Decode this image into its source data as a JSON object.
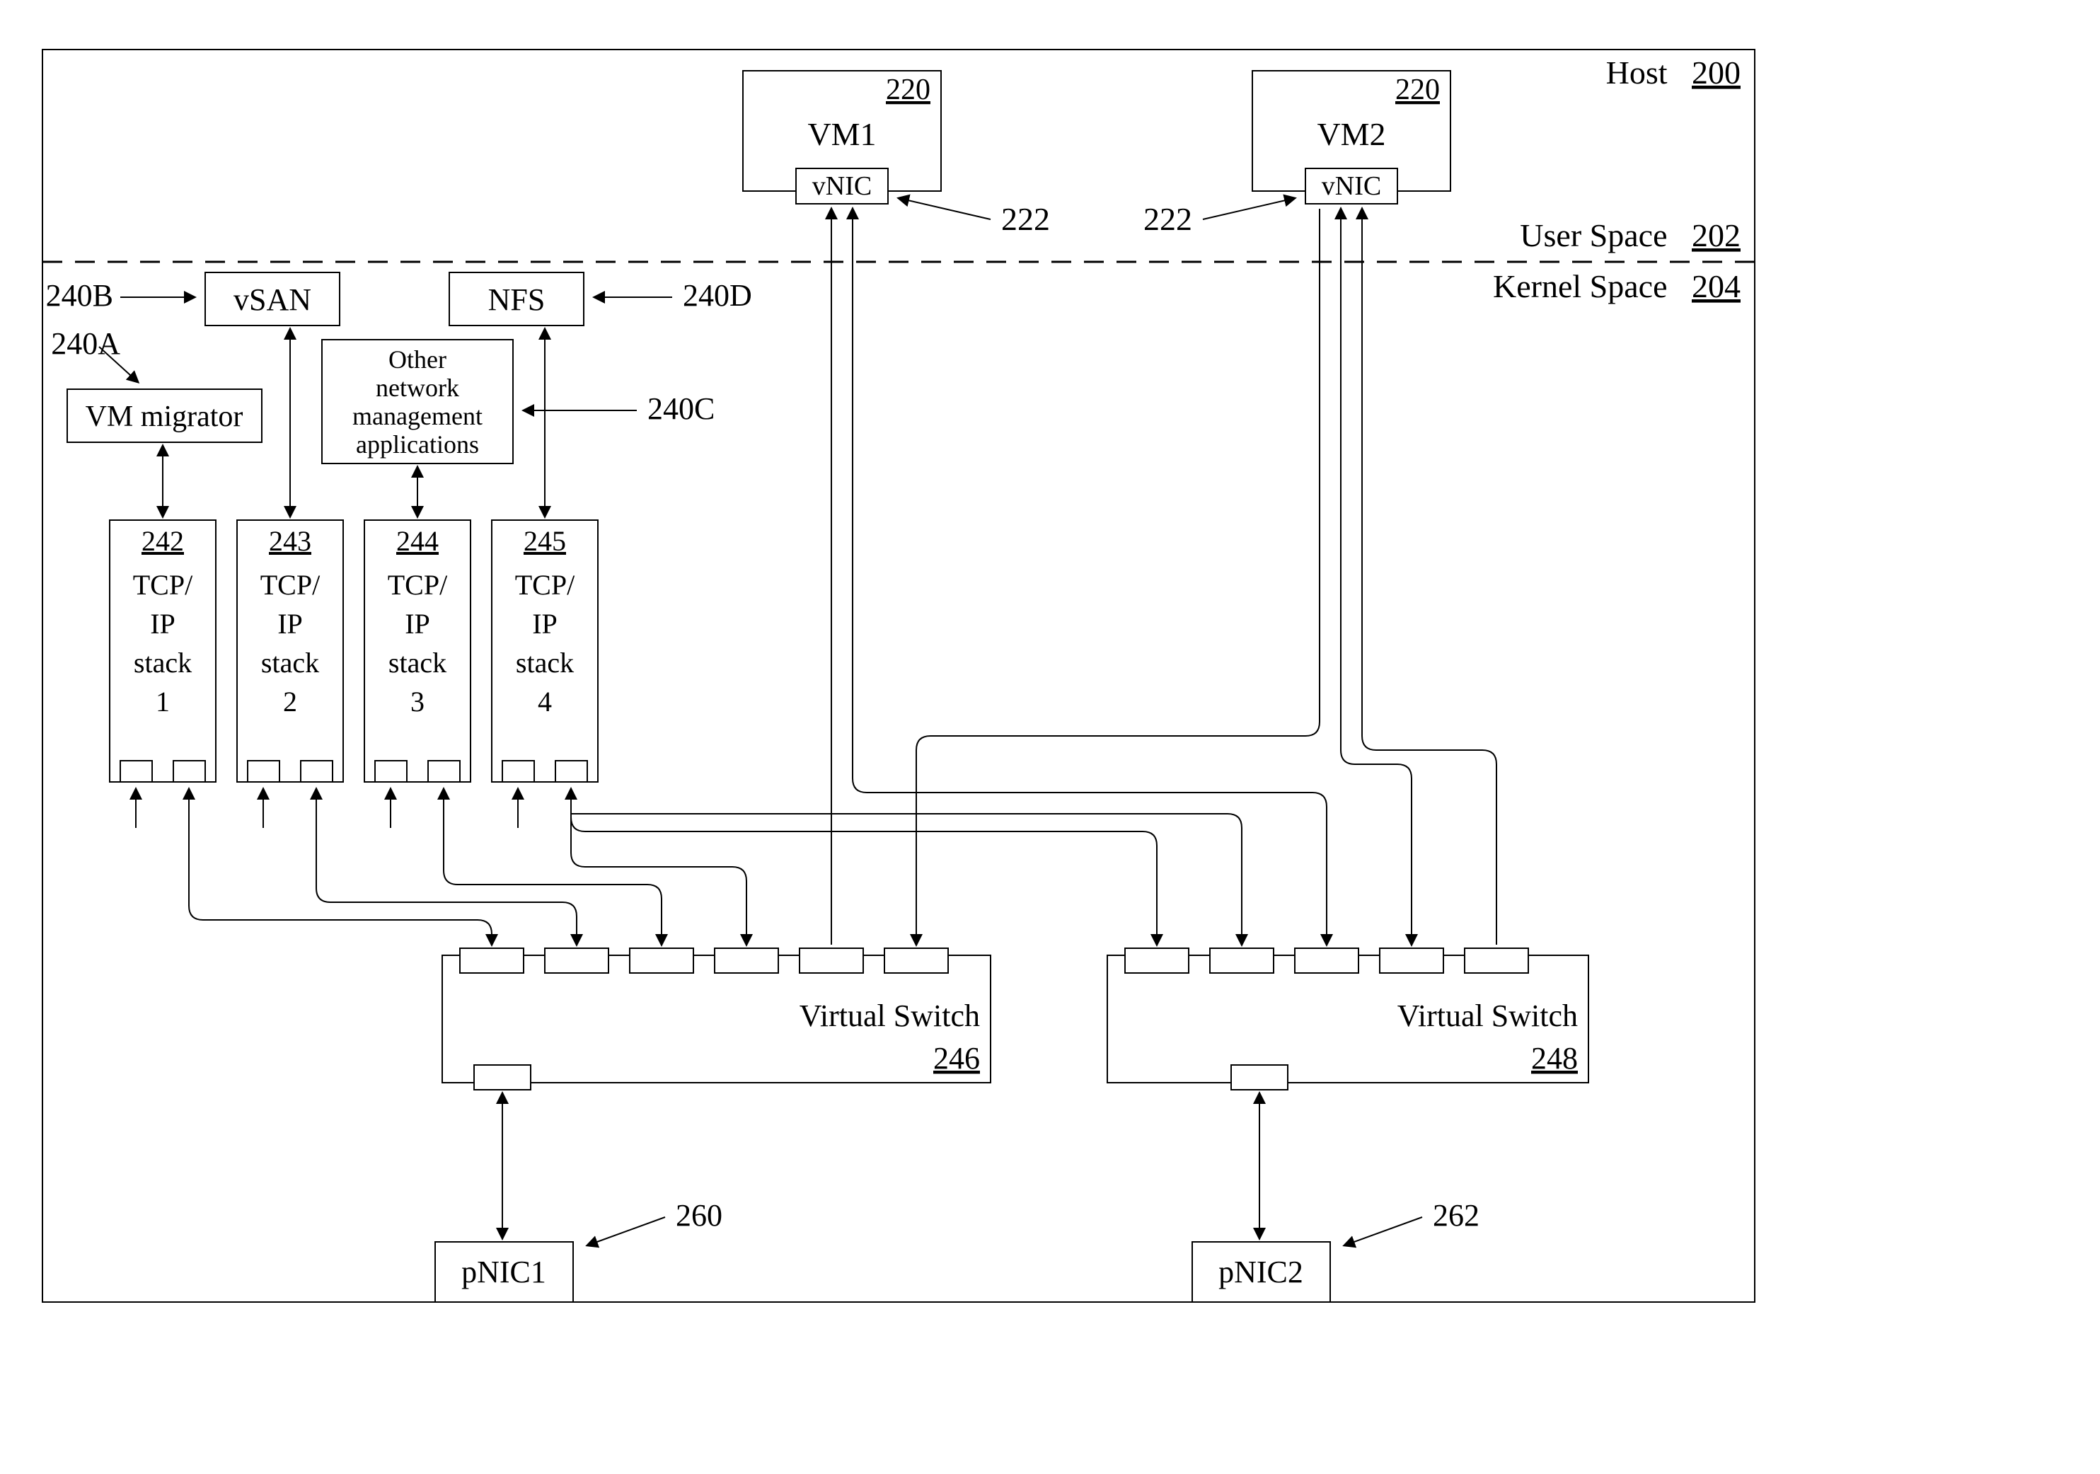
{
  "host": {
    "label": "Host",
    "ref": "200"
  },
  "user_space": {
    "label": "User Space",
    "ref": "202"
  },
  "kernel_space": {
    "label": "Kernel Space",
    "ref": "204"
  },
  "vm1": {
    "label": "VM1",
    "ref": "220",
    "nic": "vNIC",
    "callout": "222"
  },
  "vm2": {
    "label": "VM2",
    "ref": "220",
    "nic": "vNIC",
    "callout": "222"
  },
  "apps": {
    "vsan": {
      "label": "vSAN",
      "callout": "240B"
    },
    "nfs": {
      "label": "NFS",
      "callout": "240D"
    },
    "migrator": {
      "label": "VM migrator",
      "callout": "240A"
    },
    "other": {
      "line1": "Other",
      "line2": "network",
      "line3": "management",
      "line4": "applications",
      "callout": "240C"
    }
  },
  "stacks": {
    "s1": {
      "ref": "242",
      "l1": "TCP/",
      "l2": "IP",
      "l3": "stack",
      "l4": "1"
    },
    "s2": {
      "ref": "243",
      "l1": "TCP/",
      "l2": "IP",
      "l3": "stack",
      "l4": "2"
    },
    "s3": {
      "ref": "244",
      "l1": "TCP/",
      "l2": "IP",
      "l3": "stack",
      "l4": "3"
    },
    "s4": {
      "ref": "245",
      "l1": "TCP/",
      "l2": "IP",
      "l3": "stack",
      "l4": "4"
    }
  },
  "vswitch1": {
    "label": "Virtual Switch",
    "ref": "246"
  },
  "vswitch2": {
    "label": "Virtual Switch",
    "ref": "248"
  },
  "pnic1": {
    "label": "pNIC1",
    "callout": "260"
  },
  "pnic2": {
    "label": "pNIC2",
    "callout": "262"
  }
}
